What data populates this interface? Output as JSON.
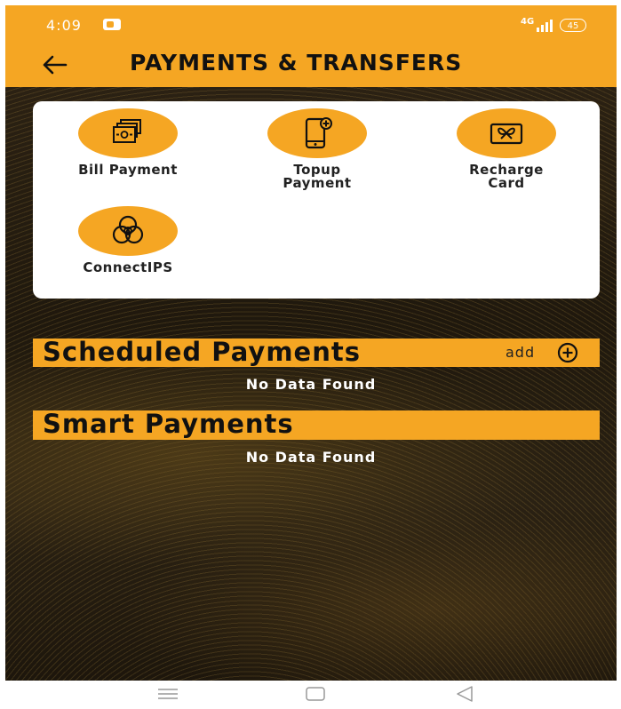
{
  "status": {
    "time": "4:09",
    "network": "4G",
    "battery": "45"
  },
  "header": {
    "title": "PAYMENTS & TRANSFERS"
  },
  "services": [
    {
      "label": "Bill Payment",
      "icon": "bill-payment-icon"
    },
    {
      "label": "Topup\nPayment",
      "icon": "mobile-topup-icon"
    },
    {
      "label": "Recharge\nCard",
      "icon": "recharge-card-icon"
    },
    {
      "label": "ConnectIPS",
      "icon": "connectips-icon"
    }
  ],
  "scheduled": {
    "title": "Scheduled Payments",
    "add_label": "add",
    "empty_text": "No Data Found"
  },
  "smart": {
    "title": "Smart Payments",
    "empty_text": "No Data Found"
  },
  "colors": {
    "accent": "#f5a623",
    "card": "#ffffff",
    "background": "#241b0f"
  }
}
